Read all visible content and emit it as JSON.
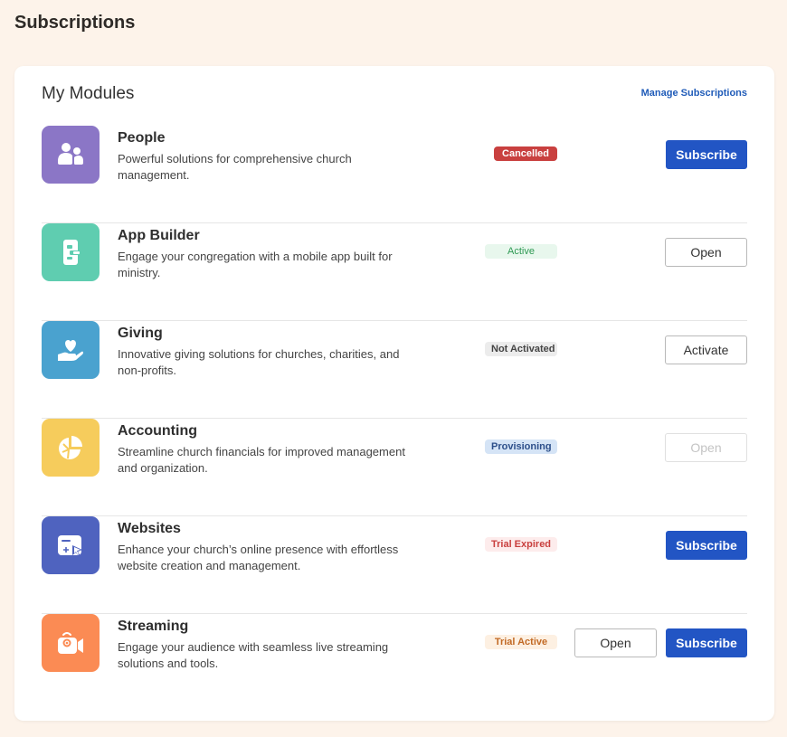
{
  "page": {
    "title": "Subscriptions"
  },
  "card": {
    "title": "My Modules",
    "manage_link": "Manage Subscriptions"
  },
  "colors": {
    "page_bg": "#fdf3ea",
    "primary": "#2255c4",
    "link": "#1f5bb8"
  },
  "modules": [
    {
      "name": "People",
      "description": "Powerful solutions for comprehensive church management.",
      "icon": "people-icon",
      "icon_color": "#8b76c6",
      "status": "Cancelled",
      "status_style": {
        "bg": "#c9403f",
        "fg": "#ffffff"
      },
      "primary_button": "Subscribe"
    },
    {
      "name": "App Builder",
      "description": "Engage your congregation with a mobile app built for ministry.",
      "icon": "mobile-app-icon",
      "icon_color": "#5fcdb0",
      "status": "Active",
      "status_style": {
        "bg": "#e8f7ed",
        "fg": "#2f9a54"
      },
      "outline_button": "Open"
    },
    {
      "name": "Giving",
      "description": "Innovative giving solutions for churches, charities, and non-profits.",
      "icon": "hand-heart-icon",
      "icon_color": "#4aa2cf",
      "status": "Not Activated",
      "status_style": {
        "bg": "#ececec",
        "fg": "#444444"
      },
      "outline_button": "Activate"
    },
    {
      "name": "Accounting",
      "description": "Streamline church financials for improved management and organization.",
      "icon": "pie-chart-icon",
      "icon_color": "#f6cc5c",
      "status": "Provisioning",
      "status_style": {
        "bg": "#d5e4f6",
        "fg": "#2d4f8a"
      },
      "disabled_button": "Open"
    },
    {
      "name": "Websites",
      "description": "Enhance your church’s online presence with effortless website creation and management.",
      "icon": "website-cursor-icon",
      "icon_color": "#4f63bf",
      "status": "Trial Expired",
      "status_style": {
        "bg": "#fdecec",
        "fg": "#c9403f"
      },
      "primary_button": "Subscribe"
    },
    {
      "name": "Streaming",
      "description": "Engage your audience with seamless live streaming solutions and tools.",
      "icon": "video-camera-icon",
      "icon_color": "#fb8b54",
      "status": "Trial Active",
      "status_style": {
        "bg": "#fdf0e2",
        "fg": "#c26a25"
      },
      "outline_button": "Open",
      "primary_button": "Subscribe"
    }
  ]
}
